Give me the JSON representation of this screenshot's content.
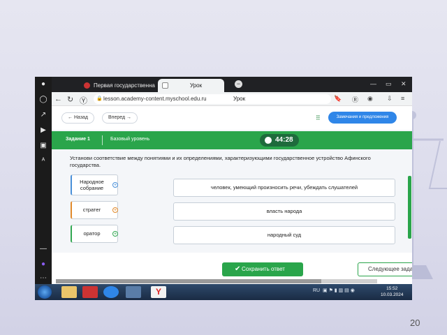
{
  "browser": {
    "tabs": [
      {
        "label": "Первая государственна"
      },
      {
        "label": "Урок"
      }
    ],
    "url": "lesson.academy-content.myschool.edu.ru",
    "url_title": "Урок"
  },
  "topnav": {
    "back_label": "← Назад",
    "forward_label": "Вперед →",
    "notes_label": "Замечания и предложения"
  },
  "task": {
    "title": "Задание 1",
    "level": "Базовый уровень",
    "timer": "44:28"
  },
  "question": "Установи соответствие между понятиями и их определениями, характеризующими государственное устройство Афинского государства.",
  "terms": [
    {
      "label": "Народное собрание"
    },
    {
      "label": "стратег"
    },
    {
      "label": "оратор"
    }
  ],
  "definitions": [
    {
      "label": "человек, умеющий произносить речи, убеждать слушателей"
    },
    {
      "label": "власть народа"
    },
    {
      "label": "народный суд"
    }
  ],
  "buttons": {
    "save_label": "Сохранить ответ",
    "next_label": "Следующее зада"
  },
  "system": {
    "tray_lang": "RU",
    "time": "15:52",
    "date": "10.03.2024"
  },
  "slide_number": "20",
  "colors": {
    "accent_green": "#2aa54b",
    "accent_blue": "#2f86e8",
    "term_blue": "#4a90d9",
    "term_orange": "#e28a2b"
  }
}
